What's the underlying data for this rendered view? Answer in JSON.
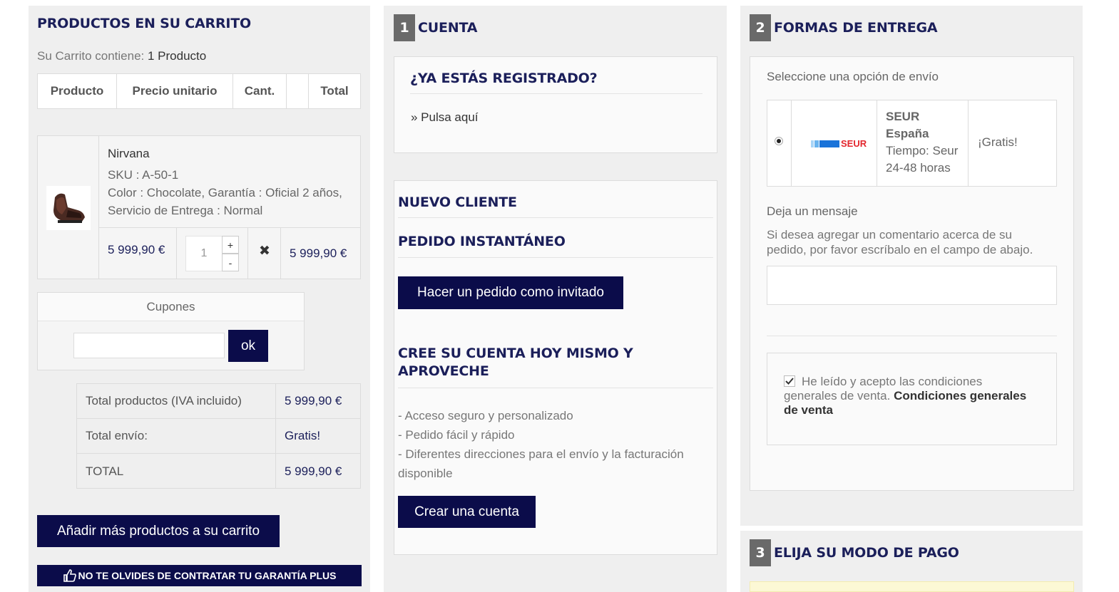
{
  "cart": {
    "title": "PRODUCTOS EN SU CARRITO",
    "contains_label": "Su Carrito contiene:",
    "contains_value": "1 Producto",
    "headers": [
      "Producto",
      "Precio unitario",
      "Cant.",
      "",
      "Total"
    ],
    "item": {
      "name": "Nirvana",
      "sku": "SKU : A-50-1",
      "attributes_line1": "Color : Chocolate, Garantía : Oficial 2 años,",
      "attributes_line2": "Servicio de Entrega : Normal",
      "unit_price": "5 999,90 €",
      "quantity": "1",
      "qty_plus": "+",
      "qty_minus": "-",
      "remove": "✖",
      "total": "5 999,90 €"
    },
    "coupons": {
      "label": "Cupones",
      "input_value": "",
      "button": "ok"
    },
    "totals": [
      {
        "label": "Total productos (IVA incluido)",
        "value": "5 999,90 €"
      },
      {
        "label": "Total envío:",
        "value": "Gratis!"
      },
      {
        "label": "TOTAL",
        "value": "5 999,90 €"
      }
    ],
    "add_more_button": "Añadir más productos a su carrito",
    "warranty_banner": "NO TE OLVIDES DE CONTRATAR TU GARANTÍA PLUS"
  },
  "account": {
    "step": "1",
    "title": "CUENTA",
    "registered_title": "¿YA ESTÁS REGISTRADO?",
    "registered_link": "» Pulsa aquí",
    "new_client_title": "NUEVO CLIENTE",
    "instant_title": "PEDIDO INSTANTÁNEO",
    "guest_button": "Hacer un pedido como invitado",
    "create_title_line1": "CREE SU CUENTA HOY MISMO Y",
    "create_title_line2": "APROVECHE",
    "benefits": [
      "- Acceso seguro y personalizado",
      "- Pedido fácil y rápido",
      "- Diferentes direcciones para el envío y la facturación",
      "disponible"
    ],
    "create_button": "Crear una cuenta"
  },
  "delivery": {
    "step": "2",
    "title": "FORMAS DE ENTREGA",
    "select_label": "Seleccione una opción de envío",
    "carrier": {
      "logo": "SEUR",
      "name_line1": "SEUR",
      "name_line2": "España",
      "time_line1": "Tiempo: Seur",
      "time_line2": "24-48 horas",
      "price": "¡Gratis!"
    },
    "message_label": "Deja un mensaje",
    "message_hint_line1": "Si desea agregar un comentario acerca de su",
    "message_hint_line2": "pedido, por favor escríbalo en el campo de abajo.",
    "message_value": "",
    "terms_text_line1": "He leído y acepto las condiciones",
    "terms_text_line2": "generales de venta.",
    "terms_link_part1": "Condiciones generales",
    "terms_link_part2": "de venta"
  },
  "payment": {
    "step": "3",
    "title": "ELIJA SU MODO DE PAGO"
  },
  "colors": {
    "navy": "#0b0c4a",
    "heading": "#1b1f5a",
    "column_bg": "#efefef",
    "notice_yellow": "#fcf8d5"
  }
}
